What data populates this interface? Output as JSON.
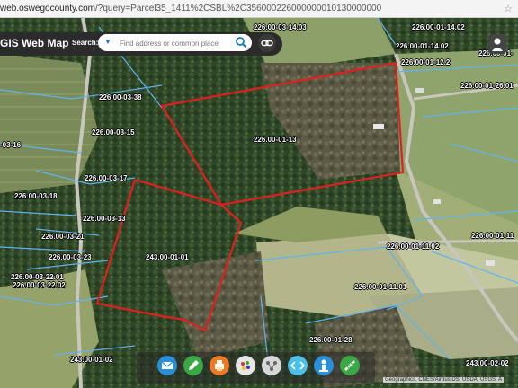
{
  "browser": {
    "url_host": "web.oswegocounty.com",
    "url_rest": "/?query=Parcel35_1411%2CSBL%2C356000226000000010130000000",
    "star": "☆"
  },
  "app": {
    "title": "GIS Web Map",
    "search_label": "Search:",
    "search_placeholder": "Find address or common place"
  },
  "parcels": [
    {
      "id": "p1",
      "label": "226.00-03-14.03"
    },
    {
      "id": "p2",
      "label": "226.00-01-14.02"
    },
    {
      "id": "p3",
      "label": "226.00-01-12.2"
    },
    {
      "id": "p4",
      "label": "226.00-01-26.01"
    },
    {
      "id": "p5",
      "label": "226.00-03-38"
    },
    {
      "id": "p6",
      "label": "226.00-03-15"
    },
    {
      "id": "p7",
      "label": "226.00-01-13"
    },
    {
      "id": "p8",
      "label": "-03-16"
    },
    {
      "id": "p9",
      "label": "226.00-03-17"
    },
    {
      "id": "p10",
      "label": "226.00-03-18"
    },
    {
      "id": "p11",
      "label": "226.00-03-13"
    },
    {
      "id": "p12",
      "label": "226.00-03-21"
    },
    {
      "id": "p13",
      "label": "226.00-03-23"
    },
    {
      "id": "p14",
      "label": "243.00-01-01"
    },
    {
      "id": "p15",
      "label": "226.00-01-11.02"
    },
    {
      "id": "p16",
      "label": "226.00-01-11"
    },
    {
      "id": "p17",
      "label": "226.00-03-22.01"
    },
    {
      "id": "p18",
      "label": "226.00-03-22.02"
    },
    {
      "id": "p19",
      "label": "226.00-01-11.01"
    },
    {
      "id": "p20",
      "label": "226.00-01-28"
    },
    {
      "id": "p21",
      "label": "243.00-01-02"
    },
    {
      "id": "p22",
      "label": "243.00-02-02"
    },
    {
      "id": "p23",
      "label": "226.00-01-"
    },
    {
      "id": "p24",
      "label": "226.00-01-14.02"
    }
  ],
  "toolbar": {
    "prev": "‹",
    "next": "›",
    "tools": [
      {
        "name": "email-tool",
        "color": "#2a8fd6"
      },
      {
        "name": "draw-tool",
        "color": "#3aa845"
      },
      {
        "name": "print-tool",
        "color": "#f07820"
      },
      {
        "name": "layers-tool",
        "color": "#9a9a9a"
      },
      {
        "name": "share-tool",
        "color": "#9a9a9a"
      },
      {
        "name": "link-tool",
        "color": "#4cc0e8"
      },
      {
        "name": "identify-tool",
        "color": "#2a8fd6"
      },
      {
        "name": "measure-tool",
        "color": "#3aa845"
      }
    ]
  },
  "attribution": "Geographics, CNES/Airbus DS, USDA, USGS, A"
}
